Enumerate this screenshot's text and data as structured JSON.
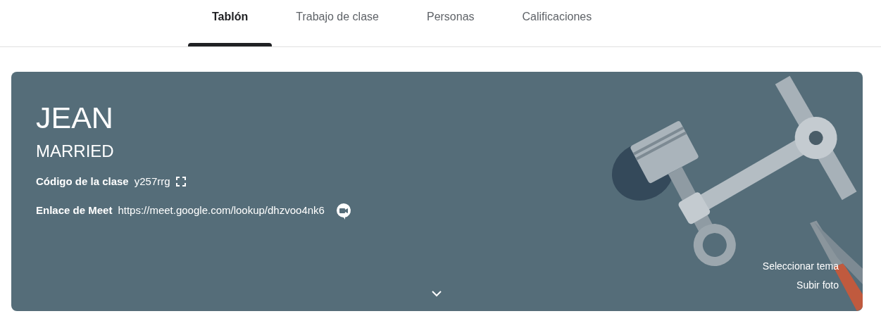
{
  "tabs": [
    {
      "label": "Tablón",
      "selected": true
    },
    {
      "label": "Trabajo de clase",
      "selected": false
    },
    {
      "label": "Personas",
      "selected": false
    },
    {
      "label": "Calificaciones",
      "selected": false
    }
  ],
  "banner": {
    "title": "JEAN",
    "subtitle": "MARRIED",
    "class_code": {
      "label": "Código de la clase",
      "value": "y257rrg"
    },
    "meet_link": {
      "label": "Enlace de Meet",
      "value": "https://meet.google.com/lookup/dhzvoo4nk6"
    },
    "actions": [
      "Seleccionar tema",
      "Subir foto"
    ]
  }
}
